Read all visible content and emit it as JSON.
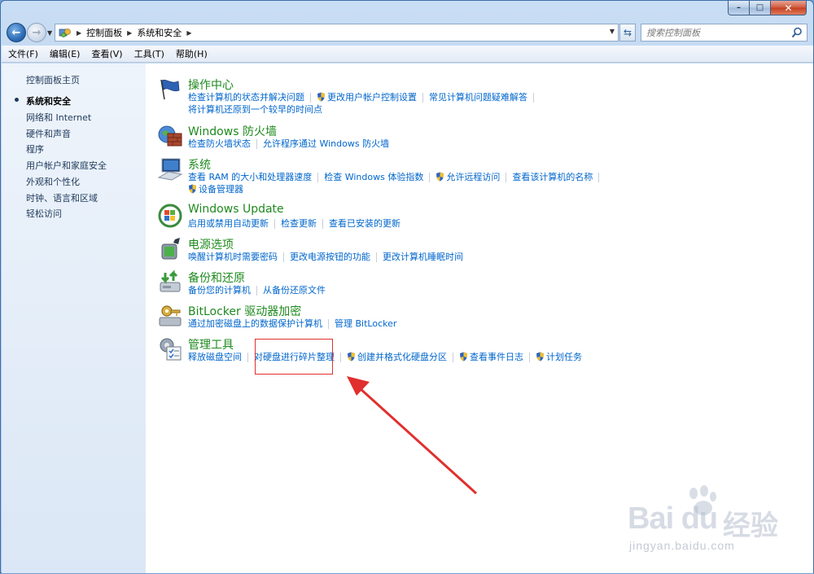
{
  "titlebar": {
    "minimize_glyph": "–",
    "maximize_glyph": "□",
    "close_glyph": "✕"
  },
  "address": {
    "breadcrumbs": [
      "控制面板",
      "系统和安全"
    ],
    "search_placeholder": "搜索控制面板"
  },
  "menu": [
    "文件(F)",
    "编辑(E)",
    "查看(V)",
    "工具(T)",
    "帮助(H)"
  ],
  "sidebar": {
    "home": "控制面板主页",
    "items": [
      {
        "label": "系统和安全",
        "current": true
      },
      {
        "label": "网络和 Internet",
        "current": false
      },
      {
        "label": "硬件和声音",
        "current": false
      },
      {
        "label": "程序",
        "current": false
      },
      {
        "label": "用户帐户和家庭安全",
        "current": false
      },
      {
        "label": "外观和个性化",
        "current": false
      },
      {
        "label": "时钟、语言和区域",
        "current": false
      },
      {
        "label": "轻松访问",
        "current": false
      }
    ]
  },
  "categories": [
    {
      "title": "操作中心",
      "icon": "action-center-flag-icon",
      "lines": [
        [
          {
            "text": "检查计算机的状态并解决问题"
          },
          {
            "text": "更改用户帐户控制设置",
            "shield": true
          },
          {
            "text": "常见计算机问题疑难解答"
          }
        ],
        [
          {
            "text": "将计算机还原到一个较早的时间点"
          }
        ]
      ]
    },
    {
      "title": "Windows 防火墙",
      "icon": "firewall-icon",
      "lines": [
        [
          {
            "text": "检查防火墙状态"
          },
          {
            "text": "允许程序通过 Windows 防火墙"
          }
        ]
      ]
    },
    {
      "title": "系统",
      "icon": "system-computer-icon",
      "lines": [
        [
          {
            "text": "查看 RAM 的大小和处理器速度"
          },
          {
            "text": "检查 Windows 体验指数"
          },
          {
            "text": "允许远程访问",
            "shield": true
          },
          {
            "text": "查看该计算机的名称"
          }
        ],
        [
          {
            "text": "设备管理器",
            "shield": true
          }
        ]
      ]
    },
    {
      "title": "Windows Update",
      "icon": "windows-update-icon",
      "lines": [
        [
          {
            "text": "启用或禁用自动更新"
          },
          {
            "text": "检查更新"
          },
          {
            "text": "查看已安装的更新"
          }
        ]
      ]
    },
    {
      "title": "电源选项",
      "icon": "power-options-icon",
      "lines": [
        [
          {
            "text": "唤醒计算机时需要密码"
          },
          {
            "text": "更改电源按钮的功能"
          },
          {
            "text": "更改计算机睡眠时间"
          }
        ]
      ]
    },
    {
      "title": "备份和还原",
      "icon": "backup-restore-icon",
      "lines": [
        [
          {
            "text": "备份您的计算机"
          },
          {
            "text": "从备份还原文件"
          }
        ]
      ]
    },
    {
      "title": "BitLocker 驱动器加密",
      "icon": "bitlocker-key-icon",
      "lines": [
        [
          {
            "text": "通过加密磁盘上的数据保护计算机"
          },
          {
            "text": "管理 BitLocker"
          }
        ]
      ]
    },
    {
      "title": "管理工具",
      "icon": "admin-tools-icon",
      "lines": [
        [
          {
            "text": "释放磁盘空间"
          },
          {
            "text": "对硬盘进行碎片整理"
          },
          {
            "text": "创建并格式化硬盘分区",
            "shield": true
          },
          {
            "text": "查看事件日志",
            "shield": true
          },
          {
            "text": "计划任务",
            "shield": true
          }
        ]
      ]
    }
  ],
  "colors": {
    "title_green": "#1e8a1e",
    "link_blue": "#0066cc",
    "annotation_red": "#e0302e"
  },
  "watermark": {
    "logo_text": "Bai du",
    "logo_cn": "经验",
    "url": "jingyan.baidu.com"
  }
}
